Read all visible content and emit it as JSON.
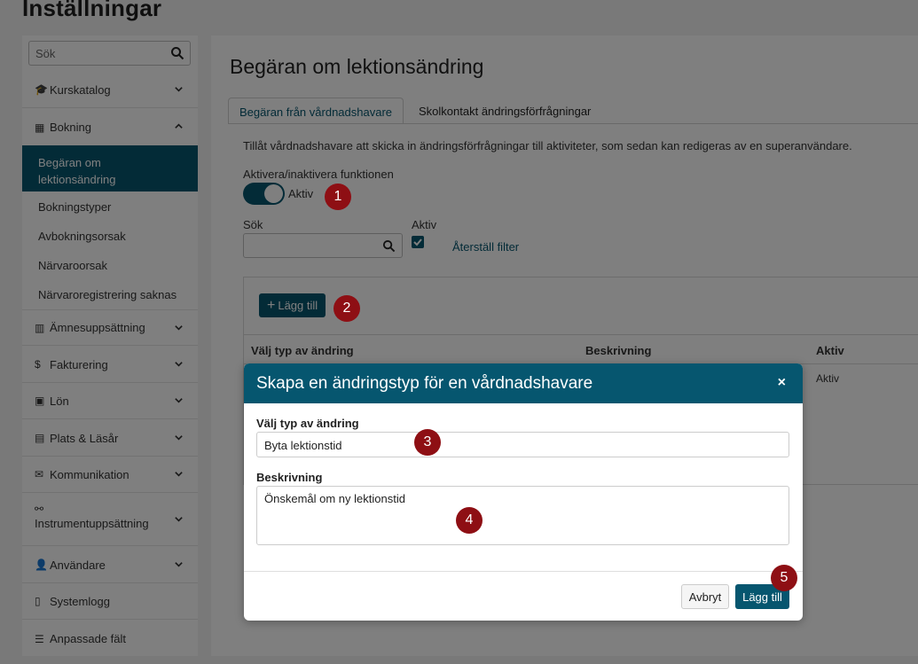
{
  "page": {
    "title": "Inställningar"
  },
  "sidebar": {
    "search_placeholder": "Sök",
    "items": [
      {
        "label": "Kurskatalog",
        "icon": "graduation-cap-icon"
      },
      {
        "label": "Bokning",
        "icon": "calendar-icon"
      },
      {
        "label": "Ämnesuppsättning",
        "icon": "books-icon"
      },
      {
        "label": "Fakturering",
        "icon": "dollar-circle-icon"
      },
      {
        "label": "Lön",
        "icon": "money-icon"
      },
      {
        "label": "Plats & Läsår",
        "icon": "building-icon"
      },
      {
        "label": "Kommunikation",
        "icon": "envelope-icon"
      },
      {
        "label": "Instrumentuppsättning",
        "icon": "binoculars-icon"
      },
      {
        "label": "Användare",
        "icon": "user-icon"
      },
      {
        "label": "Systemlogg",
        "icon": "document-icon"
      },
      {
        "label": "Anpassade fält",
        "icon": "list-icon"
      }
    ],
    "booking_sub": [
      {
        "label": "Begäran om lektionsändring",
        "active": true
      },
      {
        "label": "Bokningstyper"
      },
      {
        "label": "Avbokningsorsak"
      },
      {
        "label": "Närvaroorsak"
      },
      {
        "label": "Närvaroregistrering saknas"
      }
    ]
  },
  "main": {
    "heading": "Begäran om lektionsändring",
    "tabs": [
      {
        "label": "Begäran från vårdnadshavare",
        "active": true
      },
      {
        "label": "Skolkontakt ändringsförfrågningar"
      }
    ],
    "info_text": "Tillåt vårdnadshavare att skicka in ändringsförfrågningar till aktiviteter, som sedan kan redigeras av en superanvändare.",
    "toggle_label": "Aktivera/inaktivera funktionen",
    "toggle_state": "Aktiv",
    "search_label": "Sök",
    "active_label": "Aktiv",
    "reset_filter": "Återställ filter",
    "add_button": "Lägg till",
    "columns": [
      "Välj typ av ändring",
      "Beskrivning",
      "Aktiv"
    ],
    "row_active": "Aktiv"
  },
  "modal": {
    "title": "Skapa en ändringstyp för en vårdnadshavare",
    "close": "×",
    "type_label": "Välj typ av ändring",
    "type_value": "Byta lektionstid",
    "desc_label": "Beskrivning",
    "desc_value": "Önskemål om ny lektionstid",
    "cancel": "Avbryt",
    "submit": "Lägg till"
  },
  "markers": [
    "1",
    "2",
    "3",
    "4",
    "5"
  ],
  "colors": {
    "accent": "#06566f",
    "marker": "#8e0f14"
  }
}
